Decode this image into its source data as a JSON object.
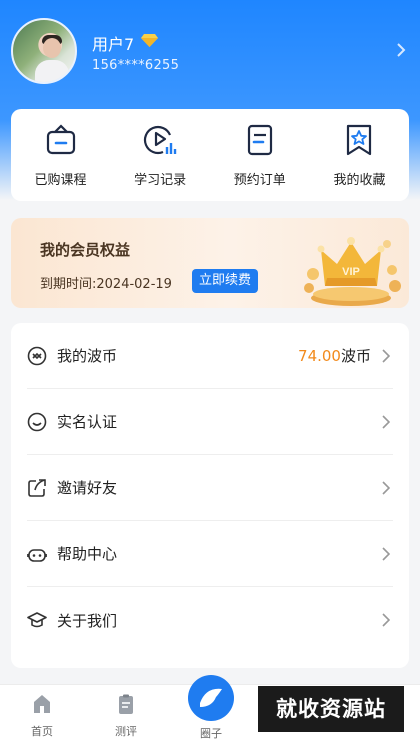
{
  "profile": {
    "username": "用户7",
    "phone": "156****6255"
  },
  "quick_actions": [
    {
      "label": "已购课程",
      "icon": "basket-icon"
    },
    {
      "label": "学习记录",
      "icon": "play-chart-icon"
    },
    {
      "label": "预约订单",
      "icon": "document-icon"
    },
    {
      "label": "我的收藏",
      "icon": "star-bookmark-icon"
    }
  ],
  "membership": {
    "title": "我的会员权益",
    "expire_label": "到期时间:",
    "expire_date": "2024-02-19",
    "renew_label": "立即续费",
    "badge": "VIP"
  },
  "menu": [
    {
      "label": "我的波币",
      "icon": "coin-icon",
      "value": "74.00",
      "unit": "波币"
    },
    {
      "label": "实名认证",
      "icon": "smile-icon"
    },
    {
      "label": "邀请好友",
      "icon": "share-icon"
    },
    {
      "label": "帮助中心",
      "icon": "headset-icon"
    },
    {
      "label": "关于我们",
      "icon": "graduation-cap-icon"
    }
  ],
  "tabbar": {
    "home": "首页",
    "review": "测评",
    "circle": "圈子"
  },
  "watermark": "就收资源站",
  "colors": {
    "primary": "#1f7cf0",
    "accent_orange": "#f28a1c",
    "vip_gold": "#f3b73a"
  }
}
